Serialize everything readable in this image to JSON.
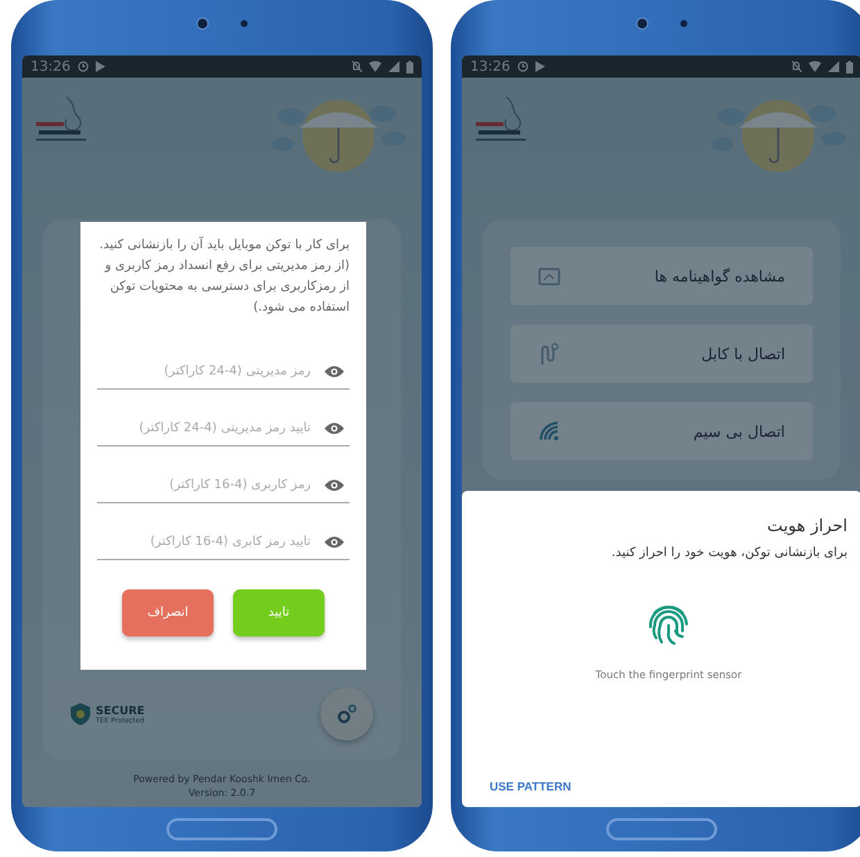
{
  "left_phone": {
    "status_bar": {
      "time": "13:26"
    },
    "dialog": {
      "message": "برای کار با توکن موبایل باید آن را بازنشانی کنید. (از رمز مدیریتی برای رفع انسداد رمز کاربری و از رمزکاربری برای دسترسی به محتویات توکن استفاده می شود.)",
      "fields": [
        {
          "placeholder": "رمز مدیریتی (4-24 کاراکتر)"
        },
        {
          "placeholder": "تایید رمز مدیریتی (4-24 کاراکتر)"
        },
        {
          "placeholder": "رمز کاربری (4-16 کاراکتر)"
        },
        {
          "placeholder": "تایید رمز کابری (4-16 کاراکتر)"
        }
      ],
      "buttons": [
        {
          "label": "تایید",
          "kind": "confirm"
        },
        {
          "label": "انصراف",
          "kind": "cancel"
        }
      ]
    },
    "secure_badge": {
      "title": "SECURE",
      "subtitle": "TEE Protected"
    },
    "footer": {
      "powered_by": "Powered by Pendar Kooshk Imen Co.",
      "version": "Version: 2.0.7"
    }
  },
  "right_phone": {
    "status_bar": {
      "time": "13:26"
    },
    "menu": [
      {
        "label": "مشاهده گواهینامه ها",
        "kind": "certificate"
      },
      {
        "label": "اتصال با کابل",
        "kind": "cable"
      },
      {
        "label": "اتصال بی سیم",
        "kind": "wireless"
      }
    ],
    "sheet": {
      "title": "احراز هویت",
      "message": "برای بازنشانی توکن، هویت خود را احراز کنید.",
      "hint": "Touch the fingerprint sensor",
      "link": "USE PATTERN"
    }
  }
}
